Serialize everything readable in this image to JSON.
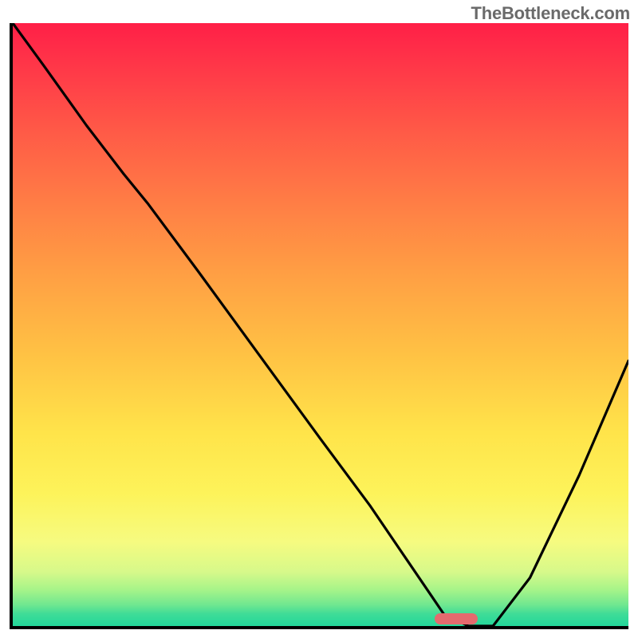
{
  "watermark": "TheBottleneck.com",
  "colors": {
    "curve": "#000000",
    "marker": "#e46a6e",
    "axis": "#000000"
  },
  "chart_data": {
    "type": "line",
    "title": "",
    "xlabel": "",
    "ylabel": "",
    "xlim": [
      0,
      100
    ],
    "ylim": [
      0,
      100
    ],
    "grid": false,
    "legend": false,
    "annotations": [
      "TheBottleneck.com"
    ],
    "note": "Axes are unlabeled in the image; values are estimated from pixel positions (bottleneck-style curve).",
    "series": [
      {
        "name": "bottleneck-curve",
        "x": [
          0,
          5,
          12,
          18,
          22,
          30,
          40,
          50,
          58,
          64,
          68,
          70,
          74,
          78,
          84,
          92,
          100
        ],
        "y": [
          100,
          93,
          83,
          75,
          70,
          59,
          45,
          31,
          20,
          11,
          5,
          2,
          0,
          0,
          8,
          25,
          44
        ]
      }
    ],
    "optimal_marker": {
      "x_center": 72,
      "y": 0,
      "width_pct": 7
    }
  }
}
